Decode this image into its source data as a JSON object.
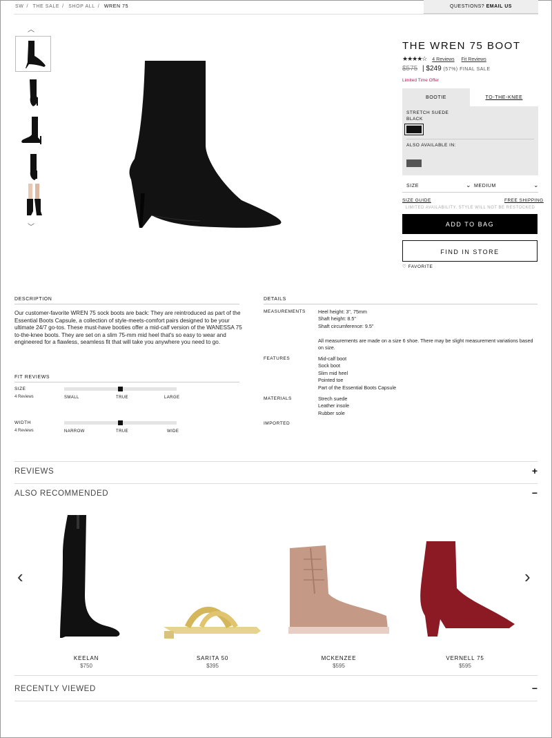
{
  "breadcrumb": [
    "SW",
    "THE SALE",
    "SHOP ALL",
    "WREN 75"
  ],
  "questions": {
    "label": "QUESTIONS?",
    "link": "EMAIL US"
  },
  "thumbnails": [
    {
      "name": "thumb-side",
      "selected": true
    },
    {
      "name": "thumb-front"
    },
    {
      "name": "thumb-back-side"
    },
    {
      "name": "thumb-front-heel"
    },
    {
      "name": "thumb-on-model"
    }
  ],
  "product": {
    "title": "THE WREN 75 BOOT",
    "rating_value": 3.5,
    "stars": "★★★★☆",
    "reviews_link": "4 Reviews",
    "fit_link": "Fit Reviews",
    "original_price": "$575",
    "sale_price": "$249",
    "discount": "(57%) FINAL SALE",
    "limited_offer": "Limited Time Offer",
    "tabs": [
      "BOOTIE",
      "TO-THE-KNEE"
    ],
    "material": "STRETCH SUEDE",
    "color": "BLACK",
    "also_available": "ALSO AVAILABLE IN:",
    "size_label": "SIZE",
    "size_value": "MEDIUM",
    "size_guide": "SIZE GUIDE",
    "free_shipping": "FREE SHIPPING",
    "limited_note": "LIMITED AVAILABILITY, STYLE WILL NOT BE RESTOCKED",
    "add_to_bag": "ADD TO BAG",
    "find_in_store": "FIND IN STORE",
    "favorite": "FAVORITE",
    "colors": {
      "black": "#111111",
      "grey": "#555555",
      "sale": "#c0185a"
    }
  },
  "description": {
    "heading": "DESCRIPTION",
    "text": "Our customer-favorite WREN 75 sock boots are back: They are reintroduced as part of the Essential Boots Capsule, a collection of style-meets-comfort pairs designed to be your ultimate 24/7 go-tos. These must-have booties offer a mid-calf version of the WANESSA 75 to-the-knee boots. They are set on a slim 75-mm mid heel that's so easy to wear and engineered for a flawless, seamless fit that will take you anywhere you need to go."
  },
  "fit": {
    "heading": "FIT REVIEWS",
    "size": {
      "label": "SIZE",
      "count": "4 Reviews",
      "scale": [
        "SMALL",
        "TRUE",
        "LARGE"
      ],
      "position": 0.5
    },
    "width": {
      "label": "WIDTH",
      "count": "4 Reviews",
      "scale": [
        "NARROW",
        "TRUE",
        "WIDE"
      ],
      "position": 0.5
    }
  },
  "details": {
    "heading": "DETAILS",
    "measurements_label": "MEASUREMENTS",
    "measurements": [
      "Heel height: 3\", 75mm",
      "Shaft height: 8.5\"",
      "Shaft circumference: 9.5\""
    ],
    "measurements_note": "All measurements are made on a size 6 shoe. There may be slight measurement variations based on size.",
    "features_label": "FEATURES",
    "features": [
      "Mid-calf boot",
      "Sock boot",
      "Slim mid heel",
      "Pointed toe",
      "Part of the Essential Boots Capsule"
    ],
    "materials_label": "MATERIALS",
    "materials": [
      "Strech suede",
      "Leather insole",
      "Rubber sole"
    ],
    "imported_label": "IMPORTED"
  },
  "accordions": {
    "reviews": {
      "label": "REVIEWS",
      "symbol": "+"
    },
    "recommended": {
      "label": "ALSO RECOMMENDED",
      "symbol": "−"
    },
    "recent": {
      "label": "RECENTLY VIEWED",
      "symbol": "−"
    }
  },
  "recommended": [
    {
      "name": "KEELAN",
      "price": "$750"
    },
    {
      "name": "SARITA 50",
      "price": "$395"
    },
    {
      "name": "MCKENZEE",
      "price": "$595"
    },
    {
      "name": "VERNELL 75",
      "price": "$595"
    }
  ],
  "icons": {
    "prev": "‹",
    "next": "›",
    "up": "⌃",
    "down": "⌄",
    "heart": "♡",
    "chev": "⌄"
  }
}
